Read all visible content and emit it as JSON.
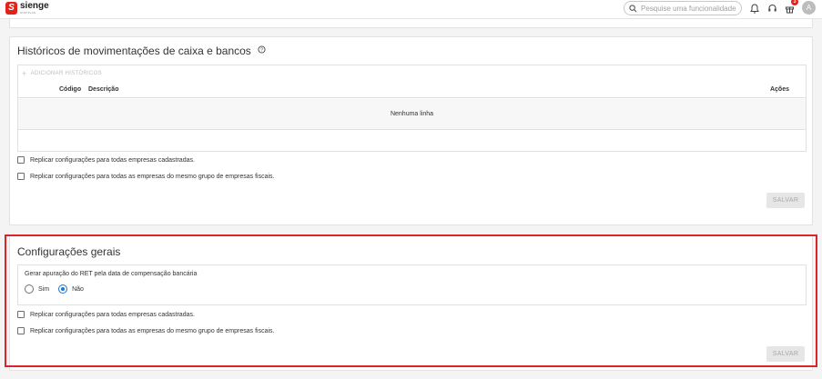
{
  "header": {
    "logo_name": "sienge",
    "logo_sub": "SOFTPLAN",
    "search_placeholder": "Pesquise uma funcionalidade",
    "notification_count": "3",
    "avatar_initial": "A"
  },
  "historicos": {
    "title": "Históricos de movimentações de caixa e bancos",
    "add_label": "ADICIONAR HISTÓRICOS",
    "columns": {
      "codigo": "Código",
      "descricao": "Descrição",
      "acoes": "Ações"
    },
    "empty_text": "Nenhuma linha",
    "replicar_todas": "Replicar configurações para todas empresas cadastradas.",
    "replicar_grupo": "Replicar configurações para todas as empresas do mesmo grupo de empresas fiscais.",
    "save_label": "SALVAR"
  },
  "geral": {
    "title": "Configurações gerais",
    "question": "Gerar apuração do RET pela data de compensação bancária",
    "options": [
      "Sim",
      "Não"
    ],
    "selected": "Não",
    "replicar_todas": "Replicar configurações para todas empresas cadastradas.",
    "replicar_grupo": "Replicar configurações para todas as empresas do mesmo grupo de empresas fiscais.",
    "save_label": "SALVAR"
  },
  "colors": {
    "accent": "#1976d2",
    "brand": "#e2231a",
    "highlight": "#d9242a"
  }
}
